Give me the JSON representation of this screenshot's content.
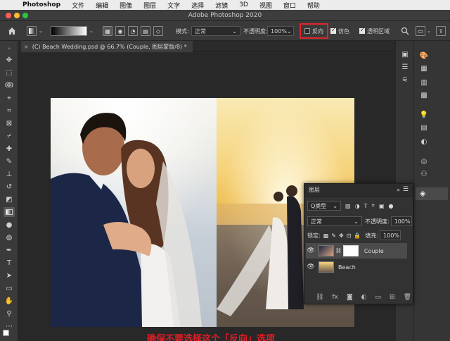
{
  "menubar": {
    "app_name": "Photoshop",
    "items": [
      "文件",
      "编辑",
      "图像",
      "图层",
      "文字",
      "选择",
      "滤镜",
      "3D",
      "视图",
      "窗口",
      "帮助"
    ]
  },
  "window": {
    "title": "Adobe Photoshop 2020"
  },
  "options": {
    "mode_label": "模式:",
    "mode_value": "正常",
    "opacity_label": "不透明度:",
    "opacity_value": "100%",
    "reverse_label": "反向",
    "dither_label": "仿色",
    "transparency_label": "透明区域"
  },
  "document": {
    "tab_title": "(C) Beach Wedding.psd @ 66.7% (Couple, 图层蒙版/8) *"
  },
  "layers_panel": {
    "title": "图层",
    "filter_kind": "Q类型",
    "blend_mode": "正常",
    "opacity_label": "不透明度:",
    "opacity_value": "100%",
    "lock_label": "锁定:",
    "fill_label": "填充:",
    "fill_value": "100%",
    "layers": [
      {
        "name": "Couple"
      },
      {
        "name": "Beach"
      }
    ]
  },
  "caption": {
    "text": "确保不要选择这个「反向」选项"
  },
  "colors": {
    "accent_red": "#e0242a",
    "panel_bg": "#323232",
    "app_bg": "#2b2b2b"
  }
}
